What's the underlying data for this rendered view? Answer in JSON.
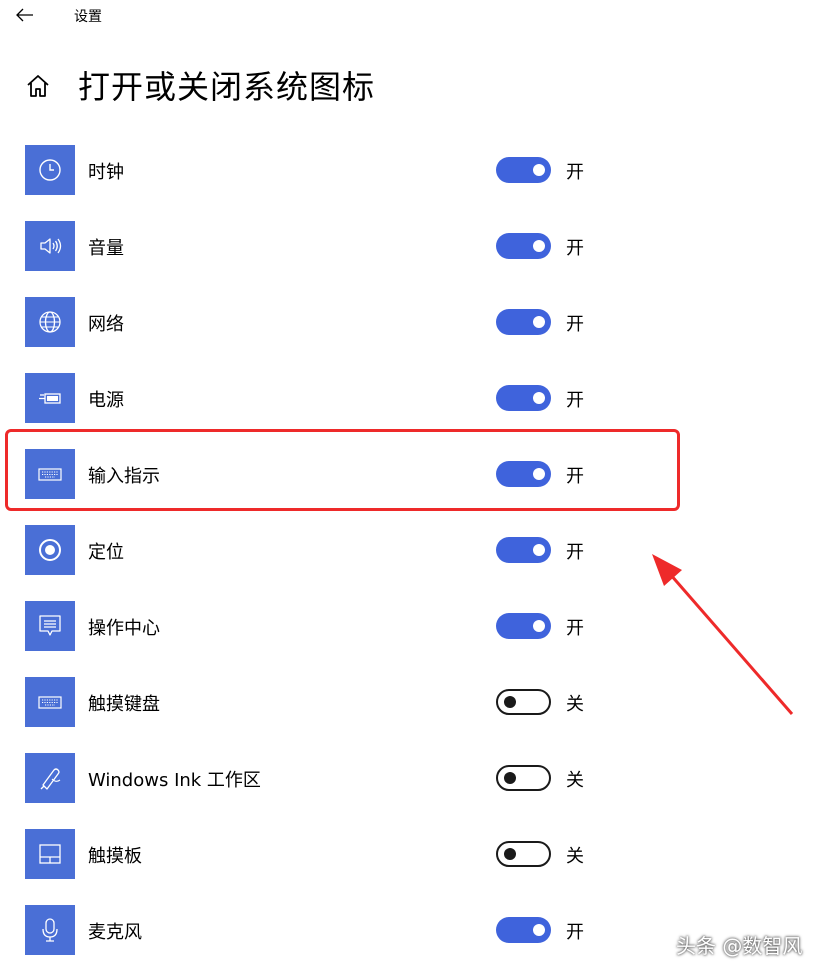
{
  "window": {
    "title": "设置"
  },
  "page": {
    "title": "打开或关闭系统图标"
  },
  "colors": {
    "accent": "#3f63dc",
    "tile": "#4a6fd6",
    "highlight": "#ee2a2a"
  },
  "icons": {
    "back": "back-arrow-icon",
    "home": "home-icon"
  },
  "items": [
    {
      "label": "时钟",
      "icon": "clock-icon",
      "on": true,
      "state": "开"
    },
    {
      "label": "音量",
      "icon": "volume-icon",
      "on": true,
      "state": "开"
    },
    {
      "label": "网络",
      "icon": "globe-icon",
      "on": true,
      "state": "开"
    },
    {
      "label": "电源",
      "icon": "battery-icon",
      "on": true,
      "state": "开"
    },
    {
      "label": "输入指示",
      "icon": "keyboard-icon",
      "on": true,
      "state": "开"
    },
    {
      "label": "定位",
      "icon": "location-icon",
      "on": true,
      "state": "开"
    },
    {
      "label": "操作中心",
      "icon": "action-center-icon",
      "on": true,
      "state": "开"
    },
    {
      "label": "触摸键盘",
      "icon": "keyboard-icon",
      "on": false,
      "state": "关"
    },
    {
      "label": "Windows Ink 工作区",
      "icon": "pen-icon",
      "on": false,
      "state": "关"
    },
    {
      "label": "触摸板",
      "icon": "touchpad-icon",
      "on": false,
      "state": "关"
    },
    {
      "label": "麦克风",
      "icon": "microphone-icon",
      "on": true,
      "state": "开"
    }
  ],
  "annotation": {
    "highlighted_item": "输入指示"
  },
  "watermark": "头条 @数智风"
}
